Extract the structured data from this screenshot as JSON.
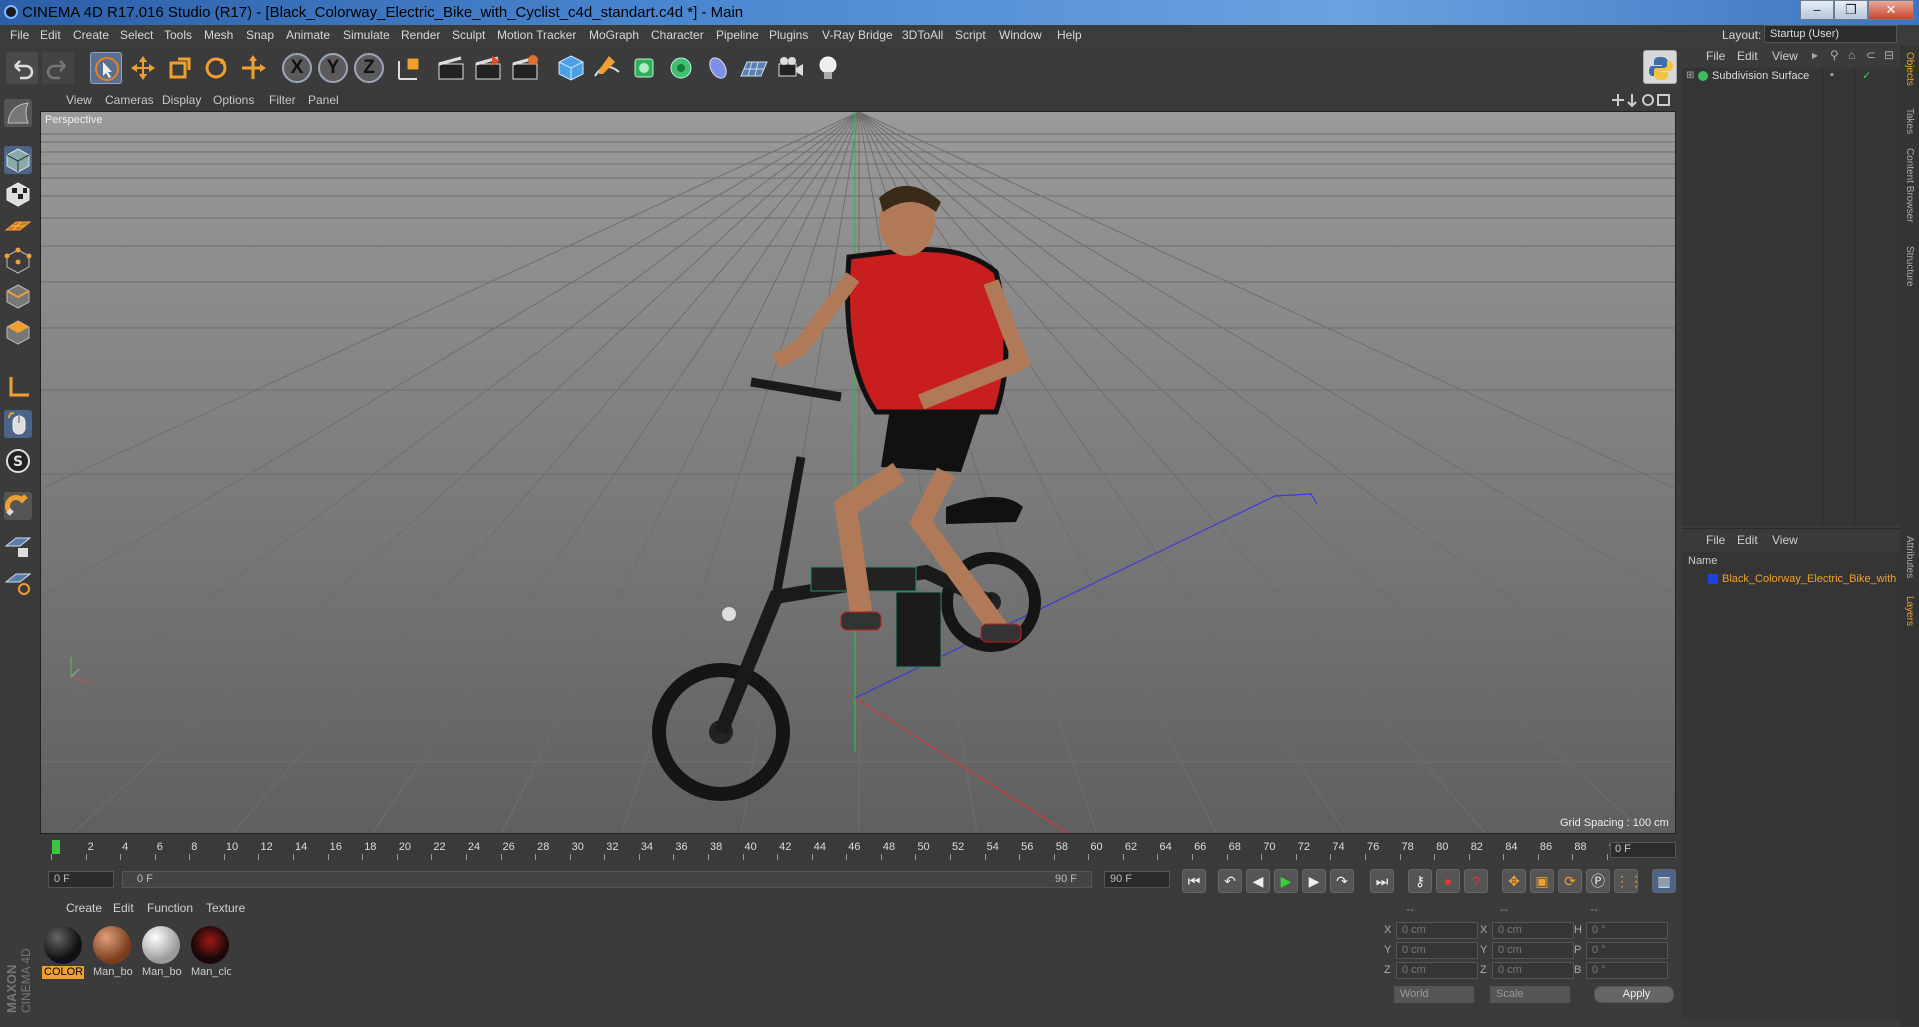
{
  "window": {
    "title": "CINEMA 4D R17.016 Studio (R17) - [Black_Colorway_Electric_Bike_with_Cyclist_c4d_standart.c4d *] - Main",
    "controls": [
      "–",
      "❐",
      "✕"
    ]
  },
  "menubar": {
    "items": [
      "File",
      "Edit",
      "Create",
      "Select",
      "Tools",
      "Mesh",
      "Snap",
      "Animate",
      "Simulate",
      "Render",
      "Sculpt",
      "Motion Tracker",
      "MoGraph",
      "Character",
      "Pipeline",
      "Plugins",
      "V-Ray Bridge",
      "3DToAll",
      "Script",
      "Window",
      "Help"
    ],
    "layout_label": "Layout:",
    "layout_value": "Startup (User)"
  },
  "toolbar": {
    "axis_x": "X",
    "axis_y": "Y",
    "axis_z": "Z"
  },
  "viewport": {
    "menu": [
      "View",
      "Cameras",
      "Display",
      "Options",
      "Filter",
      "Panel"
    ],
    "label": "Perspective",
    "grid_spacing": "Grid Spacing : 100 cm"
  },
  "timeline": {
    "ticks": [
      "0",
      "2",
      "4",
      "6",
      "8",
      "10",
      "12",
      "14",
      "16",
      "18",
      "20",
      "22",
      "24",
      "26",
      "28",
      "30",
      "32",
      "34",
      "36",
      "38",
      "40",
      "42",
      "44",
      "46",
      "48",
      "50",
      "52",
      "54",
      "56",
      "58",
      "60",
      "62",
      "64",
      "66",
      "68",
      "70",
      "72",
      "74",
      "76",
      "78",
      "80",
      "82",
      "84",
      "86",
      "88",
      "90"
    ],
    "current_frame": "0 F"
  },
  "transport": {
    "start_field": "0 F",
    "range_start": "0 F",
    "range_end": "90 F",
    "end_field": "90 F"
  },
  "materials": {
    "menu": [
      "Create",
      "Edit",
      "Function",
      "Texture"
    ],
    "items": [
      {
        "label": "COLORI",
        "color": "#1a1a1a",
        "selected": true
      },
      {
        "label": "Man_bo",
        "color": "#a2603a",
        "selected": false
      },
      {
        "label": "Man_bo",
        "color": "#d0d0d0",
        "selected": false
      },
      {
        "label": "Man_clo",
        "color": "#2a0d0d",
        "selected": false
      }
    ]
  },
  "coordinates": {
    "headers": [
      "--",
      "--",
      "--"
    ],
    "rows": [
      {
        "a": "X",
        "av": "0 cm",
        "b": "X",
        "bv": "0 cm",
        "c": "H",
        "cv": "0 °"
      },
      {
        "a": "Y",
        "av": "0 cm",
        "b": "Y",
        "bv": "0 cm",
        "c": "P",
        "cv": "0 °"
      },
      {
        "a": "Z",
        "av": "0 cm",
        "b": "Z",
        "bv": "0 cm",
        "c": "B",
        "cv": "0 °"
      }
    ],
    "world": "World",
    "scale": "Scale",
    "apply": "Apply"
  },
  "objects": {
    "menu": [
      "File",
      "Edit",
      "View"
    ],
    "items": [
      {
        "name": "Subdivision Surface"
      }
    ]
  },
  "layers": {
    "menu": [
      "File",
      "Edit",
      "View"
    ],
    "column": "Name",
    "items": [
      {
        "name": "Black_Colorway_Electric_Bike_with"
      }
    ]
  },
  "side_tabs": [
    "Objects",
    "Takes",
    "Content Browser",
    "Structure",
    "Attributes",
    "Layers"
  ],
  "maxon_logo": "MAXON CINEMA 4D",
  "colors": {
    "accent": "#f0a030",
    "selection": "#5a8fd0"
  }
}
